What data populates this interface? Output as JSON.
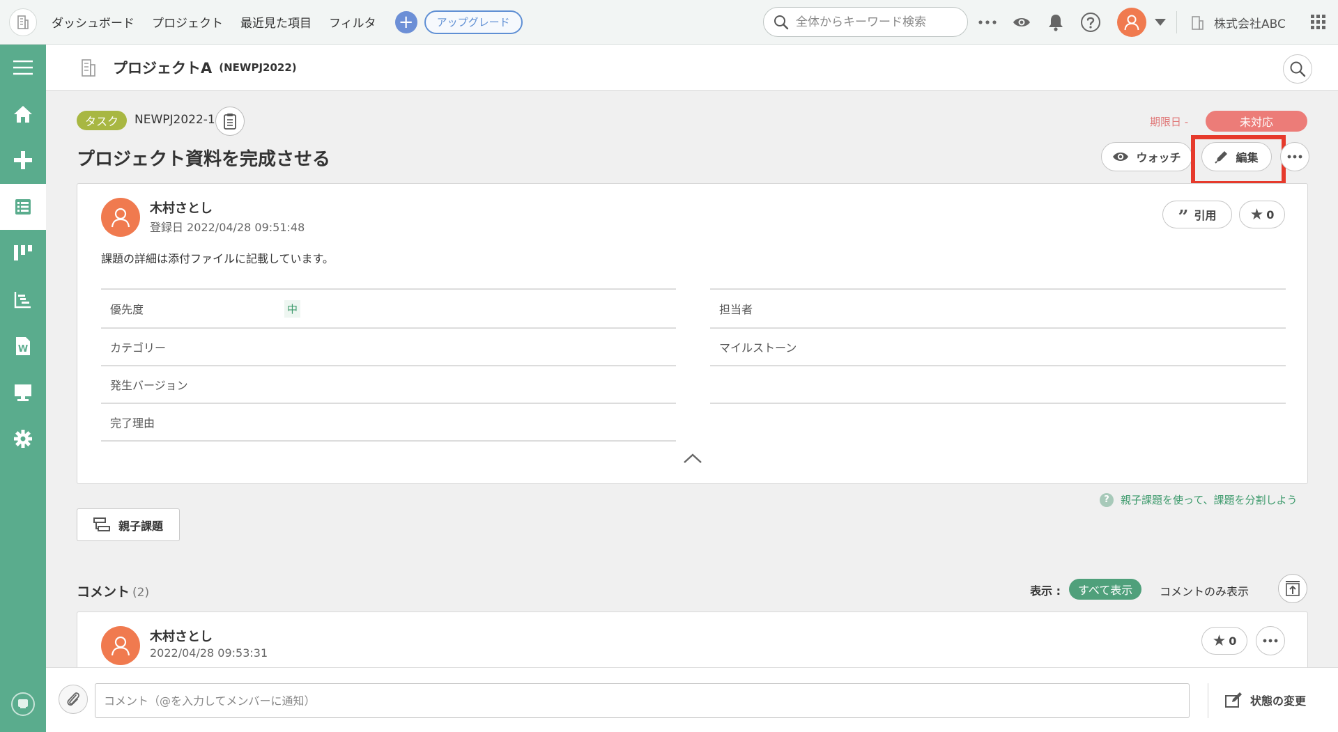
{
  "topbar": {
    "nav": [
      "ダッシュボード",
      "プロジェクト",
      "最近見た項目",
      "フィルタ"
    ],
    "upgrade_label": "アップグレード",
    "search_placeholder": "全体からキーワード検索",
    "company": "株式会社ABC"
  },
  "project": {
    "name": "プロジェクトA",
    "key": "(NEWPJ2022)"
  },
  "issue": {
    "type": "タスク",
    "key": "NEWPJ2022-1",
    "due_label": "期限日 -",
    "status": "未対応",
    "title": "プロジェクト資料を完成させる",
    "watch_label": "ウォッチ",
    "edit_label": "編集",
    "author": "木村さとし",
    "created": "登録日  2022/04/28 09:51:48",
    "quote_label": "引用",
    "star_count": "0",
    "description": "課題の詳細は添付ファイルに記載しています。",
    "properties_left": [
      {
        "label": "優先度",
        "value": "中"
      },
      {
        "label": "カテゴリー",
        "value": ""
      },
      {
        "label": "発生バージョン",
        "value": ""
      },
      {
        "label": "完了理由",
        "value": ""
      }
    ],
    "properties_right": [
      {
        "label": "担当者",
        "value": ""
      },
      {
        "label": "マイルストーン",
        "value": ""
      },
      {
        "label": "",
        "value": ""
      }
    ]
  },
  "help_link": "親子課題を使って、課題を分割しよう",
  "parent_child_label": "親子課題",
  "comments": {
    "heading": "コメント",
    "count": "(2)",
    "display_label": "表示 :",
    "show_all": "すべて表示",
    "show_comments_only": "コメントのみ表示",
    "first": {
      "author": "木村さとし",
      "date": "2022/04/28 09:53:31",
      "star_count": "0"
    }
  },
  "bottom": {
    "comment_placeholder": "コメント（@を入力してメンバーに通知）",
    "state_change_label": "状態の変更"
  },
  "colors": {
    "sidebar": "#5aac8d",
    "accent": "#4fa07b",
    "status": "#ec7c78",
    "avatar": "#f07a4f",
    "highlight": "#e63a2c"
  }
}
